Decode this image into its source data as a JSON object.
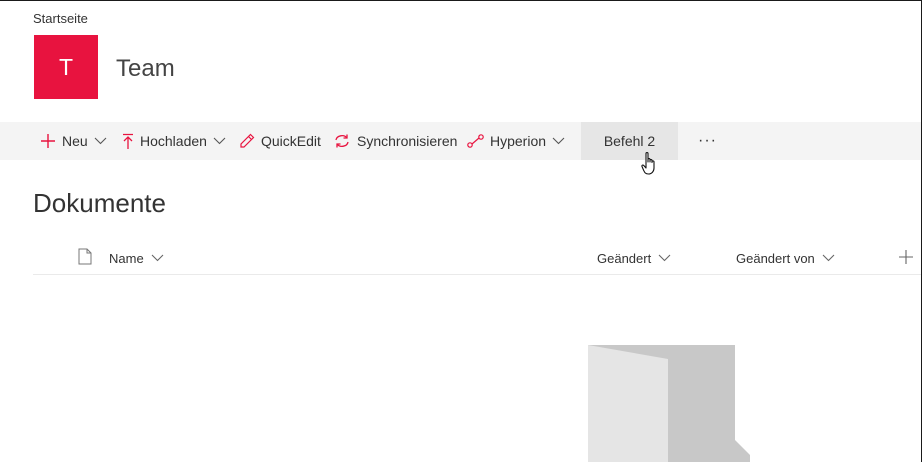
{
  "breadcrumb": "Startseite",
  "site": {
    "logo_letter": "T",
    "title": "Team",
    "accent_color": "#e8133f"
  },
  "commands": {
    "new_label": "Neu",
    "upload_label": "Hochladen",
    "quickedit_label": "QuickEdit",
    "sync_label": "Synchronisieren",
    "hyperion_label": "Hyperion",
    "befehl2_label": "Befehl 2",
    "more_label": "···"
  },
  "list": {
    "title": "Dokumente",
    "columns": {
      "name": "Name",
      "modified": "Geändert",
      "modified_by": "Geändert von"
    }
  },
  "icons": {
    "new": "plus-icon",
    "upload": "upload-icon",
    "quickedit": "pencil-icon",
    "sync": "sync-icon",
    "hyperion": "flow-icon",
    "file_type": "document-icon",
    "add_column": "plus-icon",
    "cursor": "hand-cursor-icon",
    "empty_state": "empty-folder-illustration"
  }
}
